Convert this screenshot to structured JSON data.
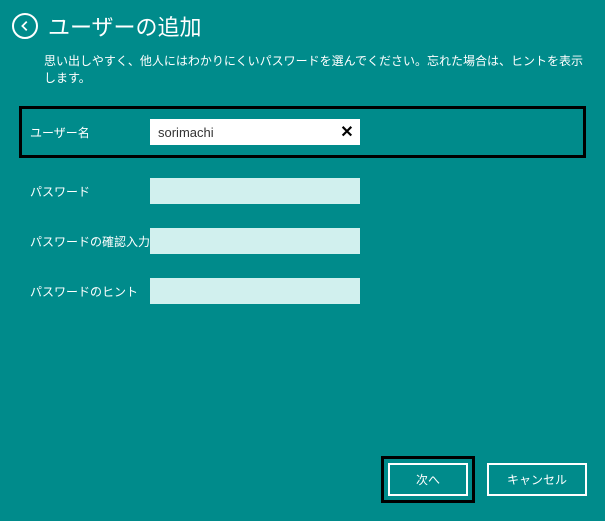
{
  "header": {
    "title": "ユーザーの追加"
  },
  "description": "思い出しやすく、他人にはわかりにくいパスワードを選んでください。忘れた場合は、ヒントを表示します。",
  "form": {
    "username": {
      "label": "ユーザー名",
      "value": "sorimachi"
    },
    "password": {
      "label": "パスワード",
      "value": ""
    },
    "password_confirm": {
      "label": "パスワードの確認入力",
      "value": ""
    },
    "password_hint": {
      "label": "パスワードのヒント",
      "value": ""
    }
  },
  "buttons": {
    "next": "次へ",
    "cancel": "キャンセル"
  },
  "icons": {
    "back": "back-arrow",
    "clear": "✕"
  }
}
